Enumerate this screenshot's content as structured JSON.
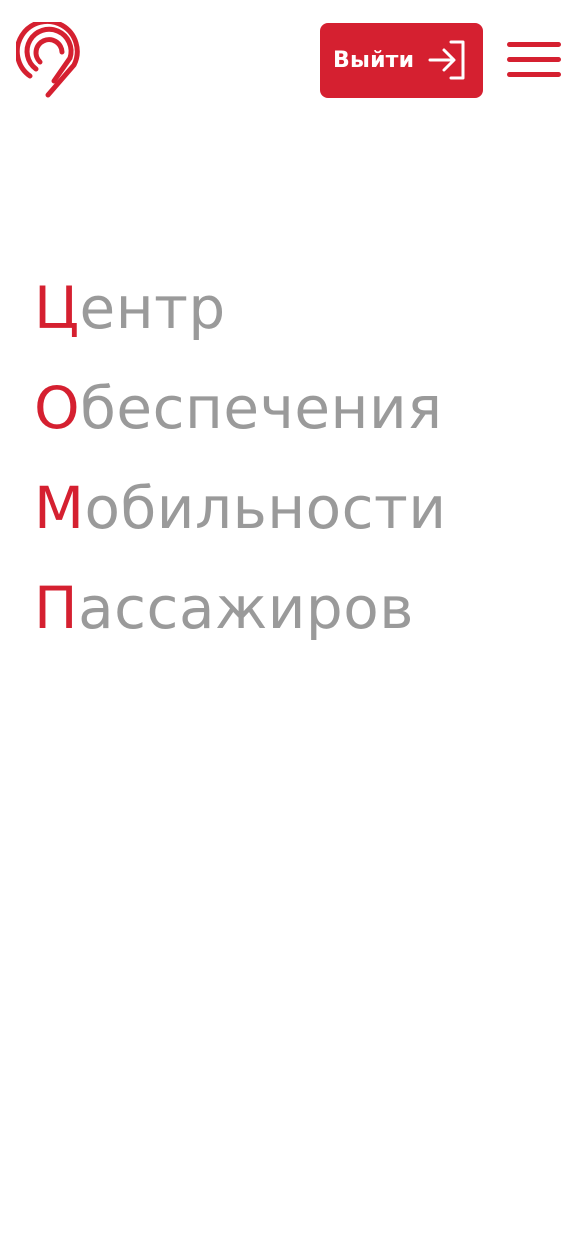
{
  "header": {
    "logo_icon": "metro-pin-logo-icon",
    "logout_label": "Выйти",
    "logout_icon": "logout-arrow-icon",
    "menu_icon": "hamburger-menu-icon",
    "accent_color": "#d52030"
  },
  "title": {
    "lines": [
      {
        "first": "Ц",
        "rest": "ентр"
      },
      {
        "first": "О",
        "rest": "беспечения"
      },
      {
        "first": "М",
        "rest": "обильности"
      },
      {
        "first": "П",
        "rest": "ассажиров"
      }
    ],
    "first_letter_color": "#d52030",
    "rest_color": "#9a9a9a"
  }
}
